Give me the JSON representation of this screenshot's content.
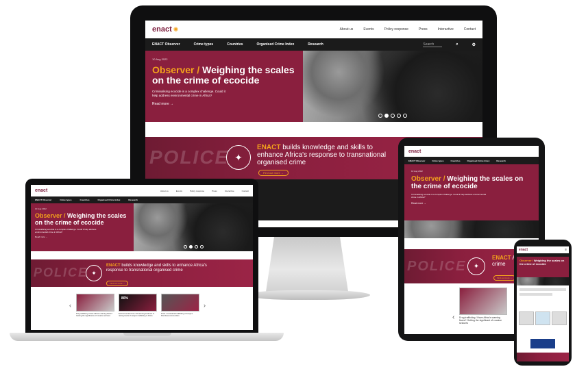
{
  "brand": {
    "logo": "enact",
    "accent": "#f3a21c",
    "primary": "#8a1f3e",
    "dark": "#1b1b1b"
  },
  "nav": [
    "About us",
    "Events",
    "Policy response",
    "Press",
    "Interactive",
    "Contact"
  ],
  "subnav": [
    "ENACT Observer",
    "Crime types",
    "Countries",
    "Organised Crime Index",
    "Research"
  ],
  "search": {
    "placeholder": "Search"
  },
  "hero": {
    "date": "10 Aug 2022",
    "kicker": "Observer /",
    "title": "Weighing the scales on the crime of ecocide",
    "summary": "Criminalising ecocide is a complex challenge. Could it help address environmental crime in Africa?",
    "cta": "Read more →"
  },
  "banner": {
    "bg_word": "POLICE",
    "brand": "ENACT",
    "text": "builds knowledge and skills to enhance Africa's response to transnational organised crime",
    "tablet_text": "Africa's r... crime",
    "cta": "Find out more →"
  },
  "laptop_cards": [
    {
      "label": "Drug trafficking / Have Africa's warning flares? Getting the significance of cocaine seizures",
      "badge": ""
    },
    {
      "label": "Environmental crime / Presenting evidence to raising levels of weapon trafficking in Africa",
      "badge": "80%"
    },
    {
      "label": "Fines / Considered trafficking in Kenya's Mombasa communities",
      "badge": ""
    }
  ],
  "tablet_card": "Drug trafficking / Have Africa's warning flares? Getting the significant of cocaine seizures"
}
